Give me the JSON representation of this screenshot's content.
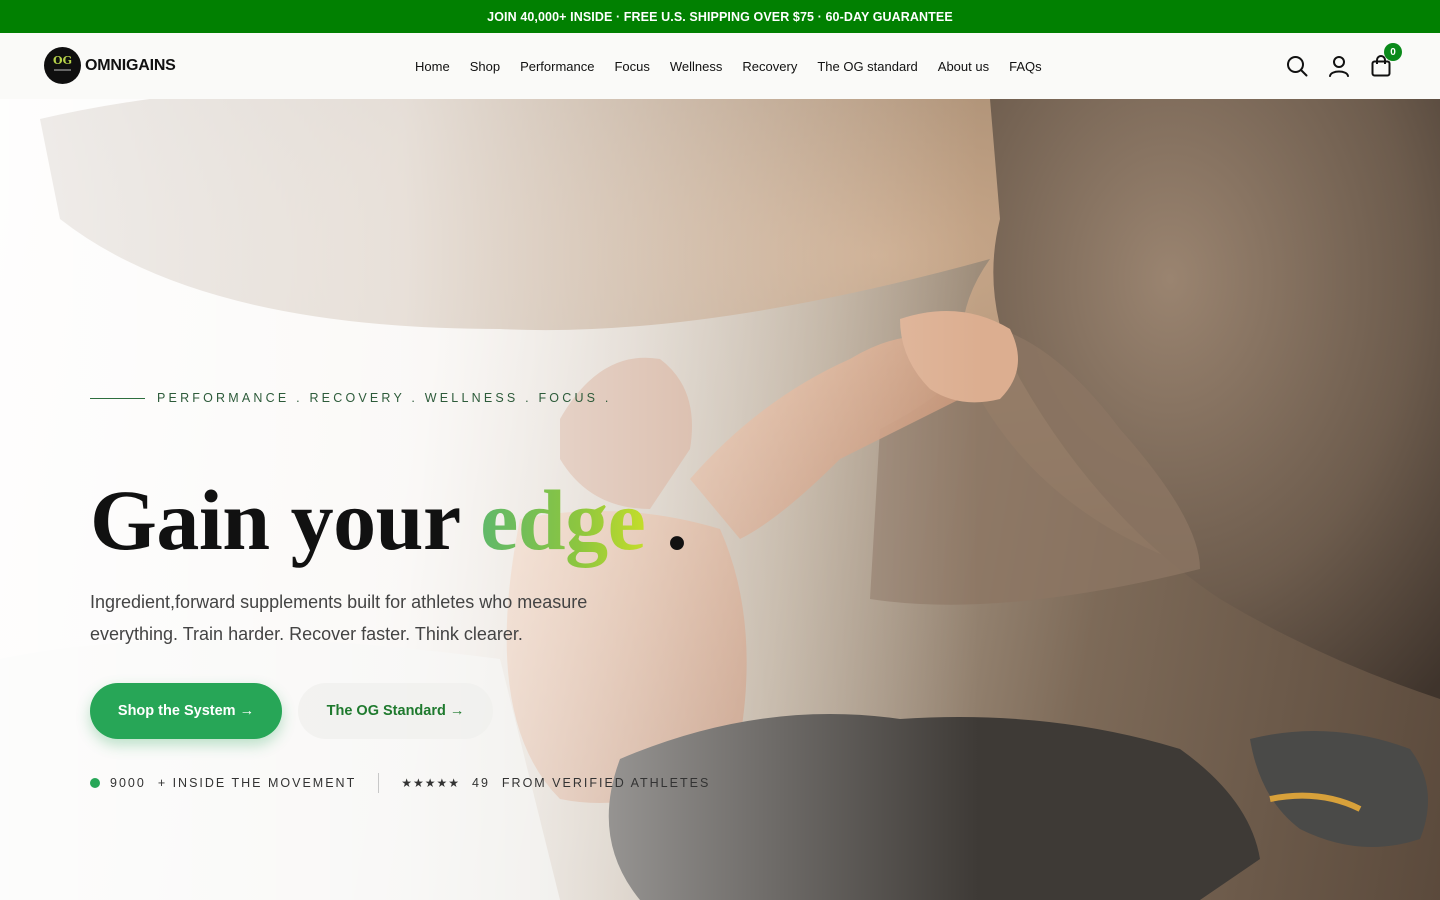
{
  "announcement": "JOIN 40,000+ INSIDE · FREE U.S. SHIPPING OVER $75 · 60-DAY GUARANTEE",
  "brand": {
    "name": "OMNIGAINS",
    "mark": "OG"
  },
  "nav": [
    "Home",
    "Shop",
    "Performance",
    "Focus",
    "Wellness",
    "Recovery",
    "The OG standard",
    "About us",
    "FAQs"
  ],
  "header_icons": {
    "search": "search-icon",
    "account": "user-icon",
    "cart": "shopping-bag-icon",
    "cart_count": "0"
  },
  "hero": {
    "eyebrow": "PERFORMANCE . RECOVERY . WELLNESS . FOCUS .",
    "headline_start": "Gain your ",
    "headline_accent": "edge",
    "headline_end": " .",
    "subcopy": "Ingredient,forward supplements built for athletes who measure everything. Train harder. Recover faster. Think clearer.",
    "cta_primary": "Shop the System →",
    "cta_secondary": "The OG Standard →",
    "stat_count": "9000",
    "stat_count_label": "+ INSIDE THE MOVEMENT",
    "stars": "★★★★★",
    "stat_rating": "49",
    "stat_rating_label": "FROM VERIFIED ATHLETES"
  },
  "colors": {
    "announce_bg": "#018001",
    "primary": "#27a657",
    "accent_green": "#8dc63f",
    "badge": "#0a8a1a"
  }
}
